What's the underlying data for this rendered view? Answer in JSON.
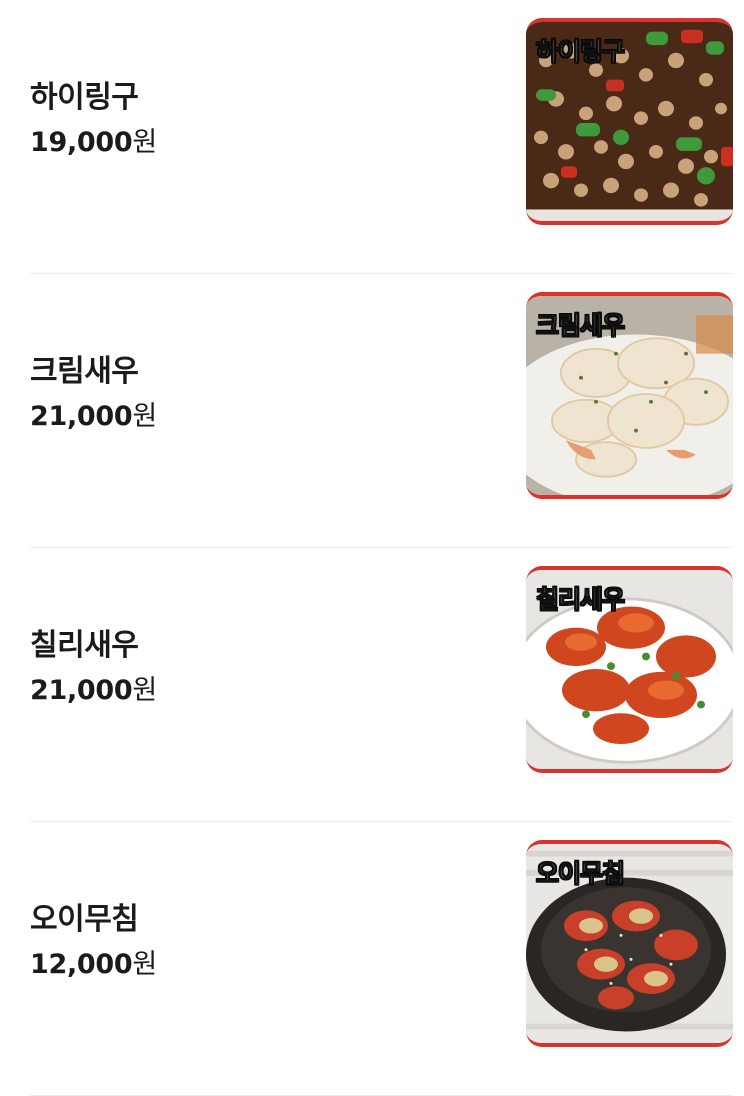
{
  "menu": {
    "items": [
      {
        "name": "하이링구",
        "price": "19,000",
        "currency": "원",
        "photo_label": "하이링구",
        "photo_icon": "stir-fried-dish-photo"
      },
      {
        "name": "크림새우",
        "price": "21,000",
        "currency": "원",
        "photo_label": "크림새우",
        "photo_icon": "cream-shrimp-photo"
      },
      {
        "name": "칠리새우",
        "price": "21,000",
        "currency": "원",
        "photo_label": "칠리새우",
        "photo_icon": "chili-shrimp-photo"
      },
      {
        "name": "오이무침",
        "price": "12,000",
        "currency": "원",
        "photo_label": "오이무침",
        "photo_icon": "cucumber-salad-photo"
      }
    ]
  },
  "colors": {
    "photo_border": "#d9342b",
    "divider": "#ececec",
    "text": "#1b1b1b"
  }
}
